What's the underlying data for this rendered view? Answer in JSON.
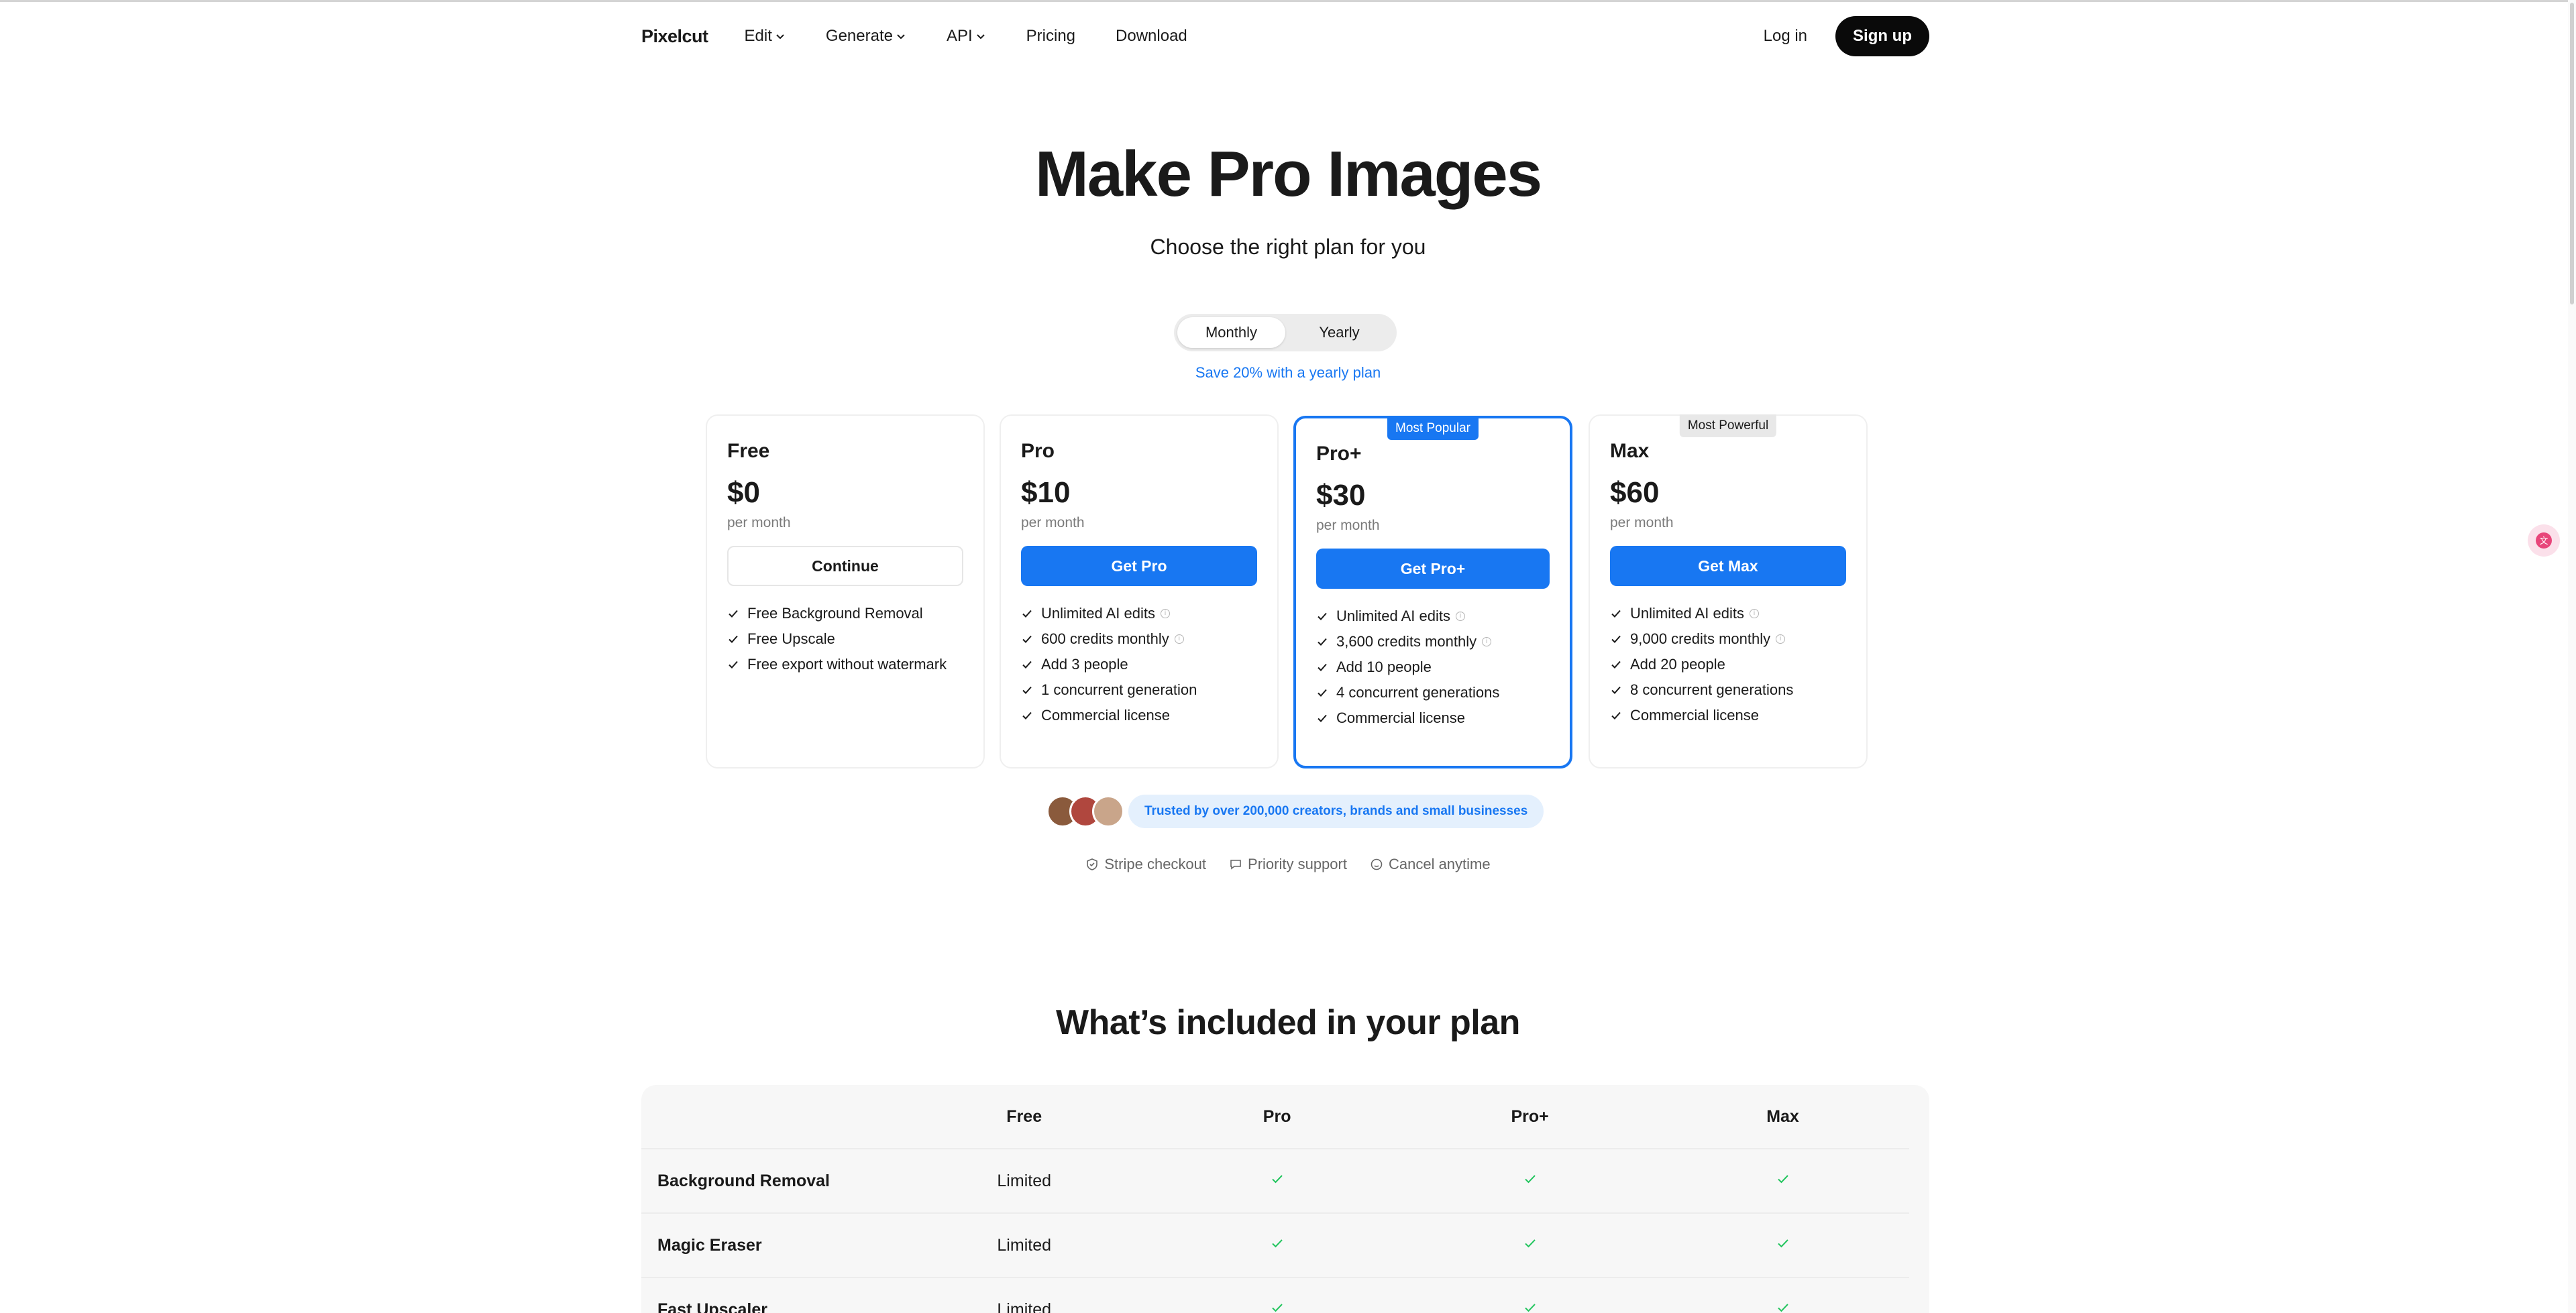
{
  "nav": {
    "logo": "Pixelcut",
    "items": [
      {
        "label": "Edit",
        "dropdown": true
      },
      {
        "label": "Generate",
        "dropdown": true
      },
      {
        "label": "API",
        "dropdown": true
      },
      {
        "label": "Pricing",
        "dropdown": false
      },
      {
        "label": "Download",
        "dropdown": false
      }
    ],
    "login": "Log in",
    "signup": "Sign up"
  },
  "hero": {
    "title": "Make Pro Images",
    "subtitle": "Choose the right plan for you"
  },
  "billing_toggle": {
    "options": [
      "Monthly",
      "Yearly"
    ],
    "selected": "Monthly",
    "note": "Save 20% with a yearly plan"
  },
  "plans": [
    {
      "name": "Free",
      "price": "$0",
      "period": "per month",
      "button": "Continue",
      "badge": "",
      "features": [
        {
          "text": "Free Background Removal",
          "info": false
        },
        {
          "text": "Free Upscale",
          "info": false
        },
        {
          "text": "Free export without watermark",
          "info": false
        }
      ]
    },
    {
      "name": "Pro",
      "price": "$10",
      "period": "per month",
      "button": "Get Pro",
      "badge": "",
      "features": [
        {
          "text": "Unlimited AI edits",
          "info": true
        },
        {
          "text": "600 credits monthly",
          "info": true
        },
        {
          "text": "Add 3 people",
          "info": false
        },
        {
          "text": "1 concurrent generation",
          "info": false
        },
        {
          "text": "Commercial license",
          "info": false
        }
      ]
    },
    {
      "name": "Pro+",
      "price": "$30",
      "period": "per month",
      "button": "Get Pro+",
      "badge": "Most Popular",
      "features": [
        {
          "text": "Unlimited AI edits",
          "info": true
        },
        {
          "text": "3,600 credits monthly",
          "info": true
        },
        {
          "text": "Add 10 people",
          "info": false
        },
        {
          "text": "4 concurrent generations",
          "info": false
        },
        {
          "text": "Commercial license",
          "info": false
        }
      ]
    },
    {
      "name": "Max",
      "price": "$60",
      "period": "per month",
      "button": "Get Max",
      "badge": "Most Powerful",
      "features": [
        {
          "text": "Unlimited AI edits",
          "info": true
        },
        {
          "text": "9,000 credits monthly",
          "info": true
        },
        {
          "text": "Add 20 people",
          "info": false
        },
        {
          "text": "8 concurrent generations",
          "info": false
        },
        {
          "text": "Commercial license",
          "info": false
        }
      ]
    }
  ],
  "trust": {
    "text": "Trusted by over 200,000 creators, brands and small businesses"
  },
  "assurances": [
    "Stripe checkout",
    "Priority support",
    "Cancel anytime"
  ],
  "included": {
    "title": "What’s included in your plan",
    "columns": [
      "Free",
      "Pro",
      "Pro+",
      "Max"
    ],
    "rows": [
      {
        "feature": "Background Removal",
        "values": [
          "Limited",
          "check",
          "check",
          "check"
        ]
      },
      {
        "feature": "Magic Eraser",
        "values": [
          "Limited",
          "check",
          "check",
          "check"
        ]
      },
      {
        "feature": "Fast Upscaler",
        "values": [
          "Limited",
          "check",
          "check",
          "check"
        ]
      }
    ]
  },
  "colors": {
    "accent": "#1877f2",
    "dark": "#0a0a0a",
    "check_green": "#22c55e"
  }
}
